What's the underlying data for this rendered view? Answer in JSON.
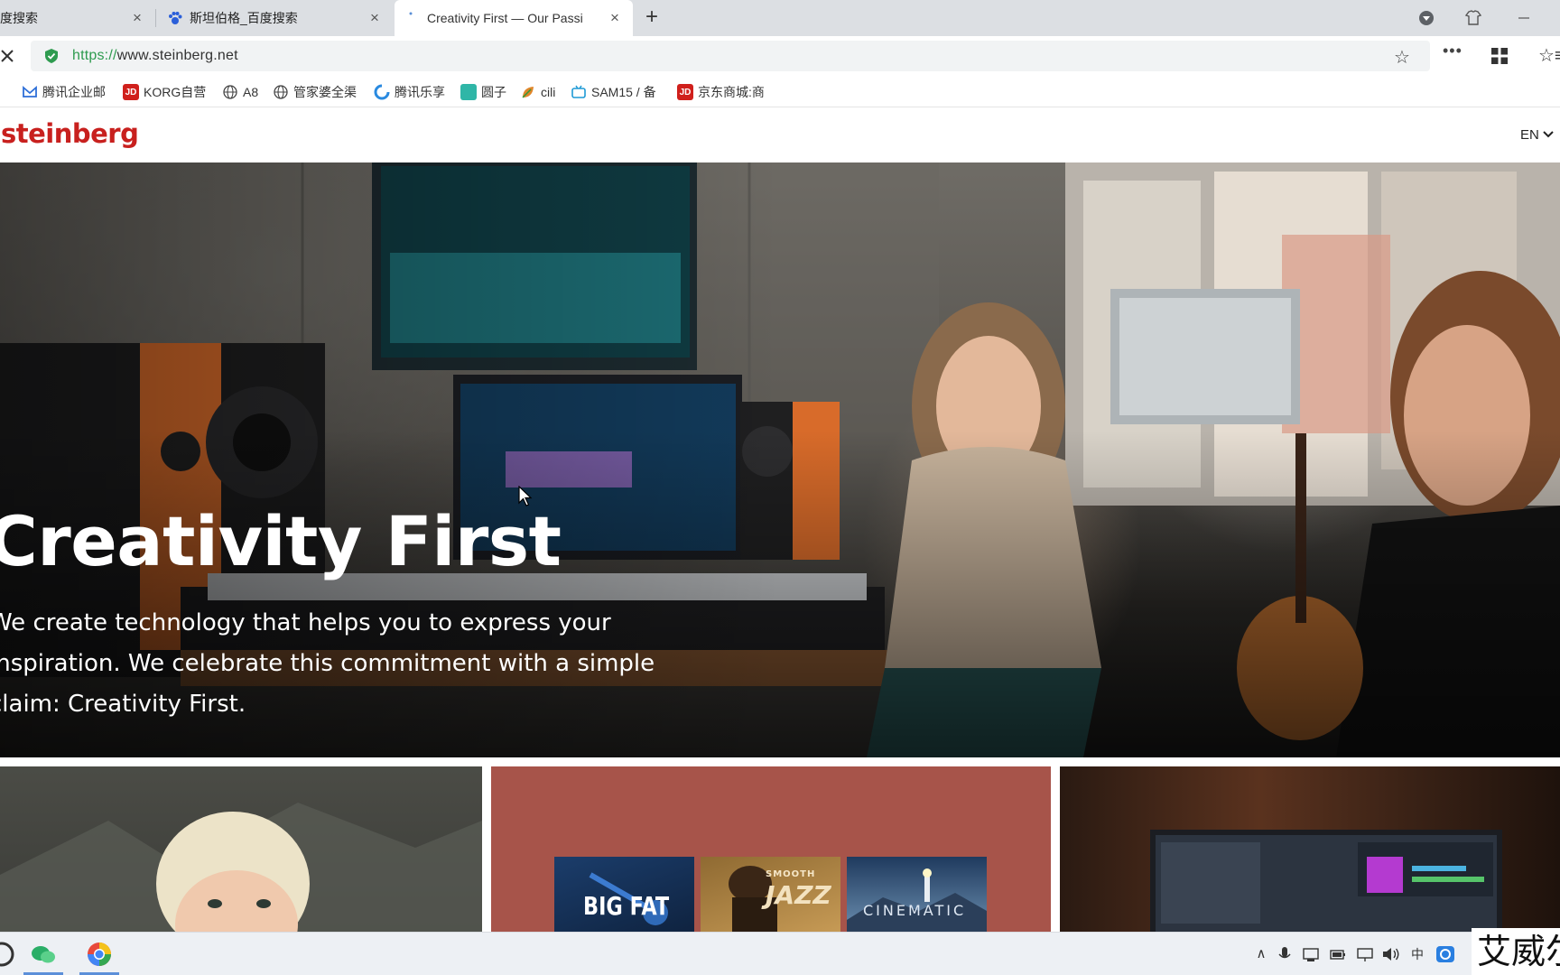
{
  "browser": {
    "tabs": [
      {
        "title": "度搜索",
        "close": "×"
      },
      {
        "title": "斯坦伯格_百度搜索",
        "close": "×"
      },
      {
        "title": "Creativity First — Our Passi",
        "close": "×"
      }
    ],
    "new_tab": "+",
    "url_scheme": "https://",
    "url_host": "www.steinberg.net",
    "bookmarks": [
      {
        "label": "腾讯企业邮",
        "icon": "envelope-icon"
      },
      {
        "label": "KORG自营",
        "icon": "jd-icon",
        "icon_text": "JD"
      },
      {
        "label": "A8",
        "icon": "globe-icon"
      },
      {
        "label": "管家婆全渠",
        "icon": "globe-icon"
      },
      {
        "label": "腾讯乐享",
        "icon": "tencent-icon"
      },
      {
        "label": "圆子",
        "icon": "app-icon"
      },
      {
        "label": "cili",
        "icon": "leaf-icon"
      },
      {
        "label": "SAM15 / 备",
        "icon": "bilibili-icon"
      },
      {
        "label": "京东商城:商",
        "icon": "jd-icon",
        "icon_text": "JD"
      }
    ]
  },
  "site": {
    "logo": "steinberg",
    "language": "EN",
    "hero": {
      "title": "Creativity First",
      "lines": [
        "We create technology that helps you to express your",
        "inspiration. We celebrate this commitment with a simple",
        "claim: Creativity First."
      ]
    },
    "albums": [
      "BIG FAT",
      "JAZZ",
      "CINEMATIC"
    ],
    "album_smooth": "SMOOTH"
  },
  "colors": {
    "brand_red": "#c8201e",
    "url_green": "#2e9b4f",
    "card_terracotta": "#a7544a"
  },
  "watermark": "艾威尔"
}
